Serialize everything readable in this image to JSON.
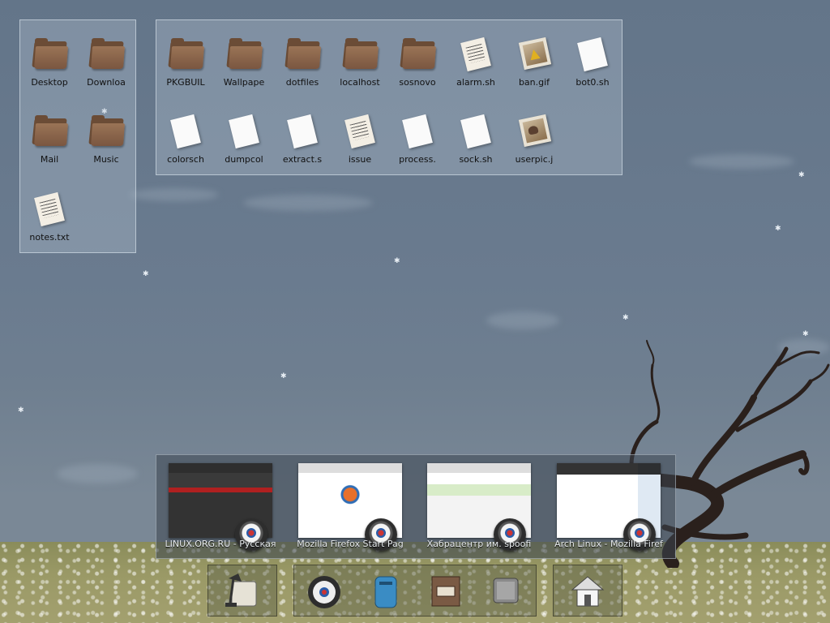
{
  "desktop_left_panel": {
    "items": [
      {
        "label": "Desktop",
        "icon": "folder-icon"
      },
      {
        "label": "Downloa",
        "icon": "folder-icon"
      },
      {
        "label": "Mail",
        "icon": "folder-icon"
      },
      {
        "label": "Music",
        "icon": "folder-icon"
      },
      {
        "label": "notes.txt",
        "icon": "text-file-icon"
      }
    ]
  },
  "desktop_right_panel": {
    "items": [
      {
        "label": "PKGBUIL",
        "icon": "folder-icon"
      },
      {
        "label": "Wallpape",
        "icon": "folder-icon"
      },
      {
        "label": "dotfiles",
        "icon": "folder-icon"
      },
      {
        "label": "localhost",
        "icon": "folder-icon"
      },
      {
        "label": "sosnovo",
        "icon": "folder-icon"
      },
      {
        "label": "alarm.sh",
        "icon": "text-file-icon"
      },
      {
        "label": "ban.gif",
        "icon": "image-file-icon"
      },
      {
        "label": "bot0.sh",
        "icon": "blank-file-icon"
      },
      {
        "label": "colorsch",
        "icon": "blank-file-icon"
      },
      {
        "label": "dumpcol",
        "icon": "blank-file-icon"
      },
      {
        "label": "extract.s",
        "icon": "blank-file-icon"
      },
      {
        "label": "issue",
        "icon": "text-file-icon"
      },
      {
        "label": "process.",
        "icon": "blank-file-icon"
      },
      {
        "label": "sock.sh",
        "icon": "blank-file-icon"
      },
      {
        "label": "userpic.j",
        "icon": "image-file-icon"
      }
    ]
  },
  "taskbar": {
    "windows": [
      {
        "title": "LINUX.ORG.RU - Русская",
        "icon": "browser-icon"
      },
      {
        "title": "Mozilla Firefox Start Pag",
        "icon": "browser-icon"
      },
      {
        "title": "Хабрацентр им. spoofi",
        "icon": "browser-icon"
      },
      {
        "title": "Arch Linux - Mozilla Firef",
        "icon": "browser-icon"
      }
    ]
  },
  "dock": {
    "group1": [
      {
        "icon": "desk-lamp-icon"
      }
    ],
    "group2": [
      {
        "icon": "web-browser-icon"
      },
      {
        "icon": "mailbox-icon"
      },
      {
        "icon": "file-cabinet-icon"
      },
      {
        "icon": "terminal-cube-icon"
      }
    ],
    "group3": [
      {
        "icon": "home-icon"
      }
    ]
  }
}
